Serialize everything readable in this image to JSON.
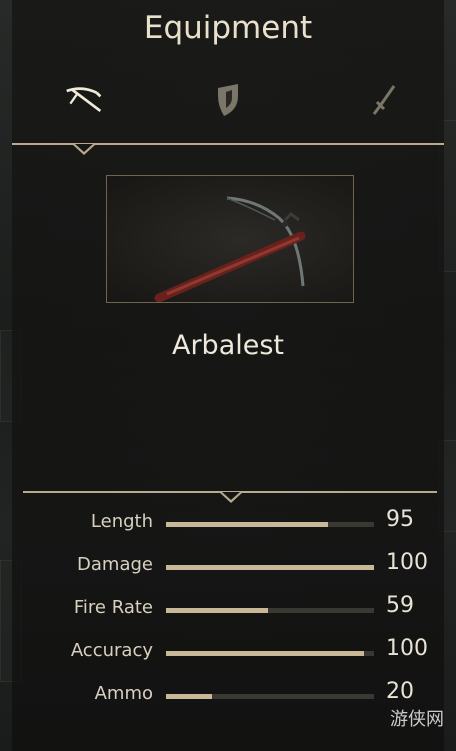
{
  "header": {
    "title": "Equipment"
  },
  "tabs": [
    {
      "name": "crossbow",
      "icon": "crossbow-icon",
      "active": true
    },
    {
      "name": "shield",
      "icon": "shield-icon",
      "active": false
    },
    {
      "name": "sword",
      "icon": "sword-icon",
      "active": false
    }
  ],
  "weapon": {
    "name": "Arbalest",
    "preview_icon": "crossbow-icon"
  },
  "stats": [
    {
      "label": "Length",
      "value": 95,
      "fill": 0.78
    },
    {
      "label": "Damage",
      "value": 100,
      "fill": 1.0
    },
    {
      "label": "Fire Rate",
      "value": 59,
      "fill": 0.49
    },
    {
      "label": "Accuracy",
      "value": 100,
      "fill": 0.95
    },
    {
      "label": "Ammo",
      "value": 20,
      "fill": 0.22
    }
  ],
  "watermark": {
    "text": "游侠网"
  },
  "colors": {
    "accent": "#b9a98e",
    "bar_fill": "#c9b898",
    "bar_track": "#3a3833",
    "text": "#e9e0cc"
  }
}
